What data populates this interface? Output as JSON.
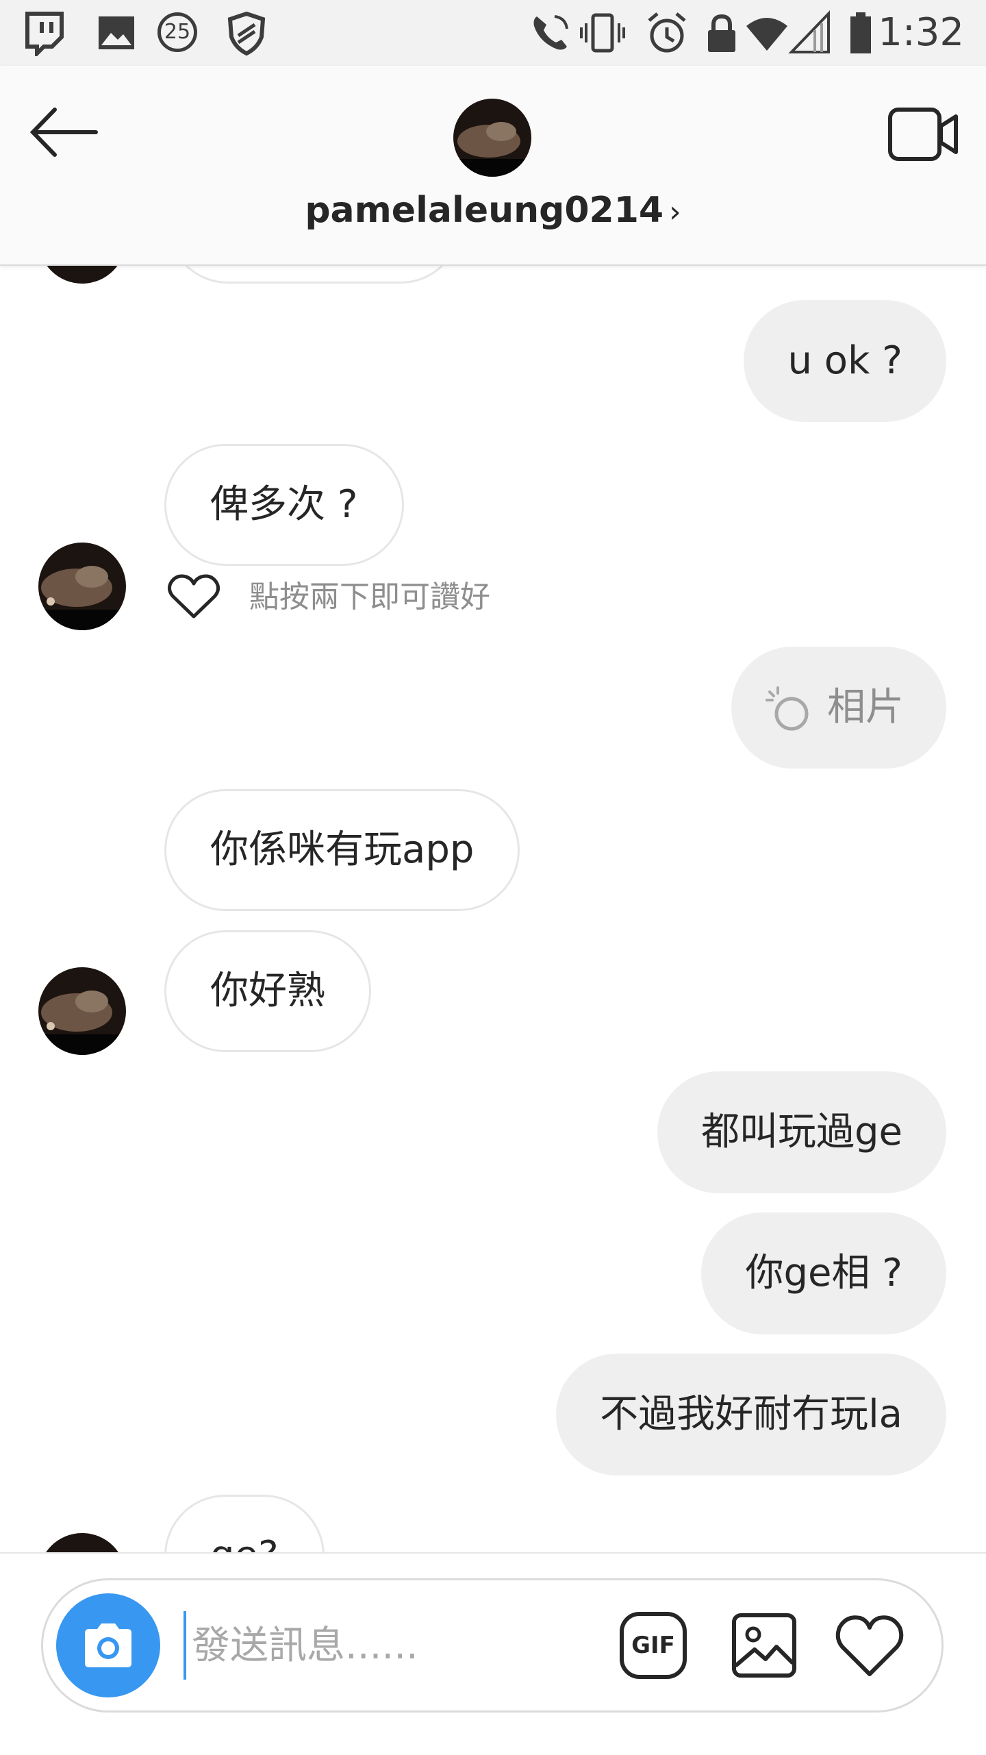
{
  "status_bar": {
    "time": "1:32",
    "notification_badge": "25",
    "icons": [
      "twitch-icon",
      "image-icon",
      "badge-25-icon",
      "shield-icon",
      "call-icon",
      "vibrate-icon",
      "alarm-icon",
      "lock-icon",
      "wifi-icon",
      "signal-icon",
      "battery-icon"
    ]
  },
  "header": {
    "username": "pamelaleung0214",
    "chevron": "›",
    "icons": [
      "back-arrow-icon",
      "video-call-icon"
    ]
  },
  "messages": [
    {
      "side": "out",
      "text": "u ok ?"
    },
    {
      "side": "in",
      "text": "俾多次 ?"
    },
    {
      "side": "in_hint",
      "text": "點按兩下即可讚好"
    },
    {
      "side": "out",
      "text": "相片",
      "type": "photo"
    },
    {
      "side": "in",
      "text": "你係咪有玩app"
    },
    {
      "side": "in",
      "text": "你好熟"
    },
    {
      "side": "out",
      "text": "都叫玩過ge"
    },
    {
      "side": "out",
      "text": "你ge相 ?"
    },
    {
      "side": "out",
      "text": "不過我好耐冇玩la"
    },
    {
      "side": "in",
      "text": "ge?"
    }
  ],
  "composer": {
    "placeholder": "發送訊息......",
    "gif_label": "GIF",
    "icons": [
      "camera-icon",
      "gif-icon",
      "gallery-icon",
      "heart-icon"
    ]
  },
  "colors": {
    "accent": "#3897f0",
    "outgoing_bubble": "#efefef",
    "incoming_border": "#e6e6e6",
    "text": "#262626",
    "muted": "#8e8e8e"
  }
}
